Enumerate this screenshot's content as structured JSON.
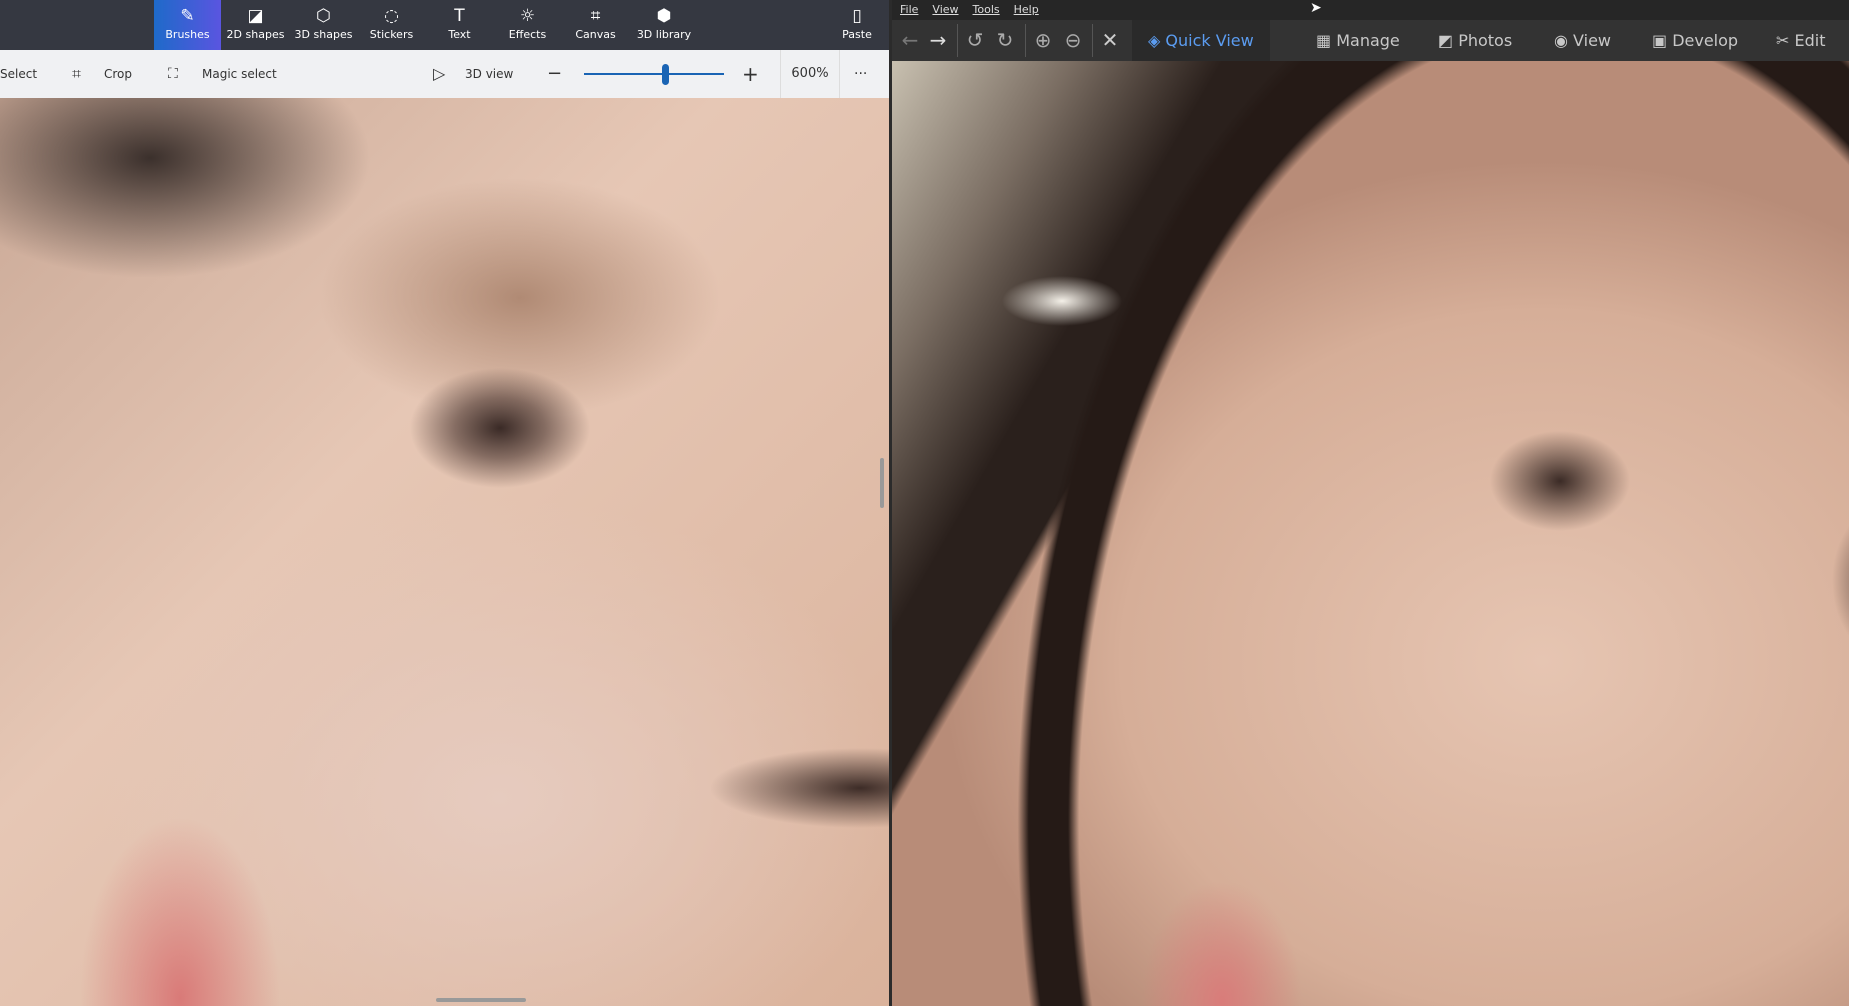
{
  "paint3d": {
    "tabs": [
      {
        "label": "Brushes",
        "icon": "brush-icon",
        "active": true
      },
      {
        "label": "2D shapes",
        "icon": "2d-shapes-icon"
      },
      {
        "label": "3D shapes",
        "icon": "3d-shapes-icon"
      },
      {
        "label": "Stickers",
        "icon": "stickers-icon"
      },
      {
        "label": "Text",
        "icon": "text-icon"
      },
      {
        "label": "Effects",
        "icon": "effects-icon"
      },
      {
        "label": "Canvas",
        "icon": "canvas-icon"
      },
      {
        "label": "3D library",
        "icon": "3d-library-icon"
      }
    ],
    "paste": "Paste",
    "toolbar": {
      "select": "Select",
      "crop": "Crop",
      "magic_select": "Magic select",
      "view3d": "3D view",
      "zoom": "600%",
      "zoom_fraction": 0.58,
      "more": "···"
    }
  },
  "viewer": {
    "menu": [
      "File",
      "View",
      "Tools",
      "Help"
    ],
    "modes": [
      {
        "label": "Quick View",
        "active": true
      },
      {
        "label": "Manage"
      },
      {
        "label": "Photos"
      },
      {
        "label": "View"
      },
      {
        "label": "Develop"
      },
      {
        "label": "Edit"
      }
    ]
  },
  "colors": {
    "accent_paint": "#1e6ac9",
    "accent_viewer": "#5b9cf0"
  }
}
